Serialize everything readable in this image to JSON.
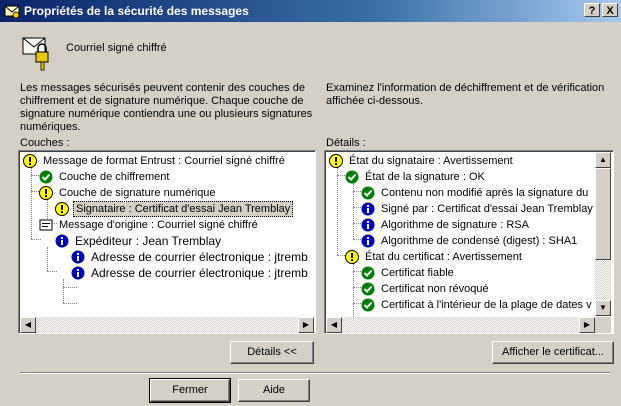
{
  "window": {
    "title": "Propriétés de la sécurité des messages",
    "help_label": "?",
    "close_label": "X"
  },
  "header": {
    "subject": "Courriel signé chiffré"
  },
  "intro": {
    "left": [
      "Les messages sécurisés peuvent contenir des couches de",
      "chiffrement et de signature numérique. Chaque couche de",
      "signature numérique contiendra une ou plusieurs signatures",
      "numériques."
    ],
    "right": [
      "Examinez l'information de déchiffrement et de vérification",
      "affichée ci-dessous."
    ]
  },
  "layers": {
    "label": "Couches :",
    "items": [
      "Message de format Entrust : Courriel signé chiffré",
      "Couche de chiffrement",
      "Couche de signature numérique",
      "Signataire : Certificat d'essai Jean Tremblay",
      "Message d'origine : Courriel signé chiffré",
      "Expéditeur : Jean Tremblay",
      "Adresse de courrier électronique : jtremb",
      "Adresse de courrier électronique : jtremb"
    ]
  },
  "details": {
    "label": "Détails :",
    "items": [
      "État du signataire : Avertissement",
      "État de la signature : OK",
      "Contenu non modifié après la signature du",
      "Signé par : Certificat d'essai Jean Tremblay",
      "Algorithme de signature : RSA",
      "Algorithme de condensé (digest) : SHA1",
      "État du certificat : Avertissement",
      "Certificat fiable",
      "Certificat non révoqué",
      "Certificat à l'intérieur de la plage de dates v"
    ]
  },
  "buttons": {
    "details_toggle": "Détails <<",
    "show_certificate": "Afficher le certificat...",
    "close": "Fermer",
    "help": "Aide"
  },
  "icons": {
    "warning": "warning-icon",
    "ok": "check-icon",
    "info": "info-icon",
    "message": "message-icon",
    "envelope": "envelope-lock-icon"
  },
  "colors": {
    "title_bar": "#0a246a",
    "warning": "#ffff00",
    "ok": "#008000",
    "info": "#0000c0"
  }
}
